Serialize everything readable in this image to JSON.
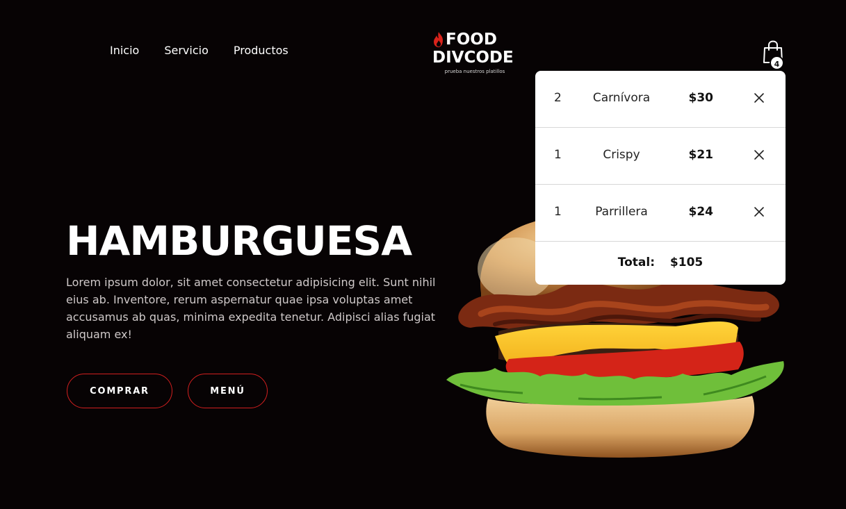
{
  "nav": {
    "items": [
      {
        "label": "Inicio"
      },
      {
        "label": "Servicio"
      },
      {
        "label": "Productos"
      }
    ]
  },
  "logo": {
    "line1": "FOOD",
    "line2": "DIVCODE",
    "tagline": "prueba nuestros platillos",
    "flame_color": "#d8231b"
  },
  "cart": {
    "count": "4",
    "items": [
      {
        "qty": "2",
        "name": "Carnívora",
        "price": "$30"
      },
      {
        "qty": "1",
        "name": "Crispy",
        "price": "$21"
      },
      {
        "qty": "1",
        "name": "Parrillera",
        "price": "$24"
      }
    ],
    "total_label": "Total:",
    "total_value": "$105"
  },
  "hero": {
    "title": "HAMBURGUESA",
    "description": "Lorem ipsum dolor, sit amet consectetur adipisicing elit. Sunt nihil eius ab. Inventore, rerum aspernatur quae ipsa voluptas amet accusamus ab quas, minima expedita tenetur. Adipisci alias fugiat aliquam ex!",
    "buttons": {
      "buy": "COMPRAR",
      "menu": "MENÚ"
    },
    "accent_color": "#d21f1f"
  },
  "icons": {
    "cart": "shopping-bag-icon",
    "remove": "close-icon",
    "logo": "flame-icon"
  }
}
